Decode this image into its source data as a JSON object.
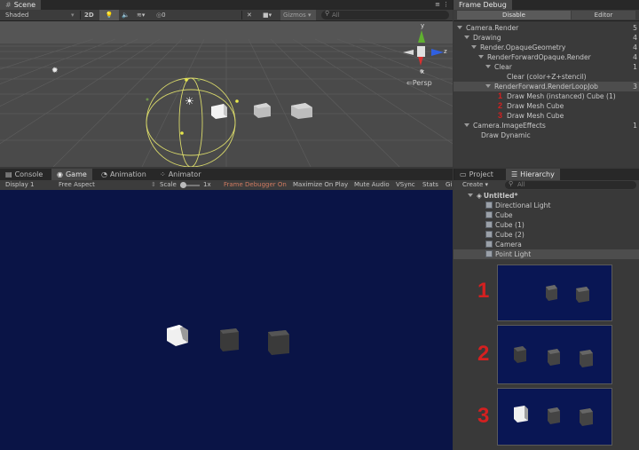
{
  "scene": {
    "tab_label": "Scene",
    "shading": "Shaded",
    "mode_2d": "2D",
    "layer_count": "0",
    "gizmos_label": "Gizmos",
    "search_placeholder": "All",
    "persp_label": "Persp",
    "axis_y": "y",
    "axis_z": "z",
    "axis_x": "x"
  },
  "frame_debug": {
    "tab_label": "Frame Debug",
    "disable_label": "Disable",
    "editor_label": "Editor",
    "rows": [
      {
        "label": "Camera.Render",
        "count": "5"
      },
      {
        "label": "Drawing",
        "count": "4"
      },
      {
        "label": "Render.OpaqueGeometry",
        "count": "4"
      },
      {
        "label": "RenderForwardOpaque.Render",
        "count": "4"
      },
      {
        "label": "Clear",
        "count": "1"
      },
      {
        "label": "Clear (color+Z+stencil)",
        "count": ""
      },
      {
        "label": "RenderForward.RenderLoopJob",
        "count": "3"
      },
      {
        "label": "Draw Mesh (instanced) Cube (1)",
        "count": "",
        "marker": "1"
      },
      {
        "label": "Draw Mesh Cube",
        "count": "",
        "marker": "2"
      },
      {
        "label": "Draw Mesh Cube",
        "count": "",
        "marker": "3"
      },
      {
        "label": "Camera.ImageEffects",
        "count": "1"
      },
      {
        "label": "Draw Dynamic",
        "count": ""
      }
    ]
  },
  "game": {
    "tabs": {
      "console": "Console",
      "game": "Game",
      "animation": "Animation",
      "animator": "Animator"
    },
    "display": "Display 1",
    "aspect": "Free Aspect",
    "scale_label": "Scale",
    "scale_value": "1x",
    "frame_debugger_on": "Frame Debugger On",
    "maximize": "Maximize On Play",
    "mute": "Mute Audio",
    "vsync": "VSync",
    "stats": "Stats",
    "gizmos_short": "Gi",
    "background_color": "#0a1446"
  },
  "hierarchy": {
    "project_tab": "Project",
    "hierarchy_tab": "Hierarchy",
    "create_label": "Create",
    "search_placeholder": "All",
    "scene_name": "Untitled*",
    "items": [
      "Directional Light",
      "Cube",
      "Cube (1)",
      "Cube (2)",
      "Camera",
      "Point Light"
    ]
  },
  "thumbnails": [
    {
      "label": "1"
    },
    {
      "label": "2"
    },
    {
      "label": "3"
    }
  ]
}
